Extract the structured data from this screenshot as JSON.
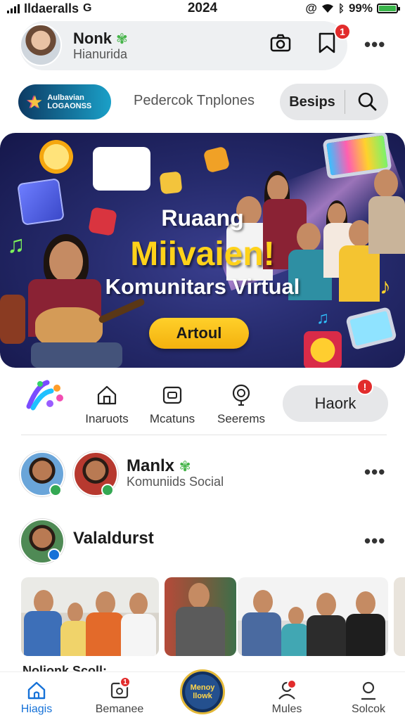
{
  "status_bar": {
    "carrier": "Ildaeralls",
    "time": "2024",
    "battery": "99%",
    "battery_level": 0.99
  },
  "profile": {
    "name": "Nonk",
    "subtitle": "Hianurida",
    "notification_count": "1"
  },
  "toolbar": {
    "brand_line1": "Aulbavian",
    "brand_line2": "LOGAONSS",
    "section_link": "Pedercok Tnplones",
    "search_label": "Besips"
  },
  "banner": {
    "title_line1": "Ruaang",
    "title_line2": "Miivaien!",
    "title_line3": "Komunitars Virtual",
    "cta_label": "Artoul"
  },
  "categories": [
    {
      "label": "Inaruots",
      "icon": "house-icon"
    },
    {
      "label": "Mcatuns",
      "icon": "square-icon"
    },
    {
      "label": "Seerems",
      "icon": "pin-icon"
    }
  ],
  "hack_pill": {
    "label": "Haork"
  },
  "feed": {
    "post1": {
      "name": "Manlx",
      "subtitle": "Komuniids Social"
    },
    "post2": {
      "name": "Valaldurst"
    },
    "caption_fragment": "Nolionk Scoll:"
  },
  "bottom_nav": [
    {
      "label": "Hiagis",
      "icon": "home-icon",
      "active": true
    },
    {
      "label": "Bemanee",
      "icon": "inbox-icon",
      "badge": true
    },
    {
      "label_line1": "Menoy",
      "label_line2": "llowk",
      "icon": "center-logo"
    },
    {
      "label": "Mules",
      "icon": "people-icon",
      "badge": true
    },
    {
      "label": "Solcok",
      "icon": "search-icon"
    }
  ],
  "colors": {
    "accent": "#1672d8",
    "badge": "#e22c2c",
    "banner_yellow": "#ffd21a",
    "online": "#34a853"
  }
}
